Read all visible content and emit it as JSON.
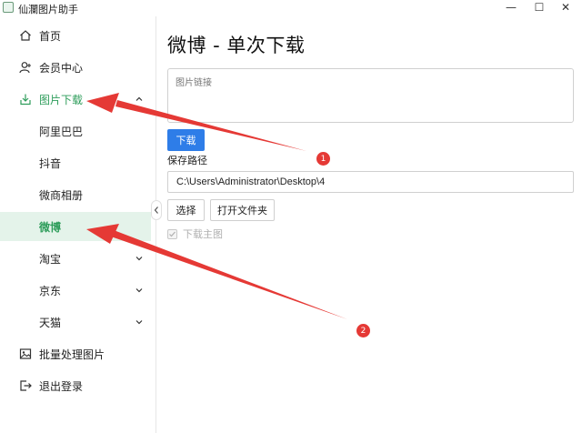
{
  "window": {
    "title": "仙瀾图片助手",
    "controls": {
      "minimize": "—",
      "maximize": "☐",
      "close": "✕"
    }
  },
  "sidebar": {
    "items": [
      {
        "label": "首页",
        "icon": "home-icon"
      },
      {
        "label": "会员中心",
        "icon": "user-icon"
      },
      {
        "label": "图片下载",
        "icon": "download-icon",
        "expanded": true
      },
      {
        "label": "阿里巴巴"
      },
      {
        "label": "抖音"
      },
      {
        "label": "微商相册"
      },
      {
        "label": "微博",
        "selected": true
      },
      {
        "label": "淘宝",
        "has_children": true
      },
      {
        "label": "京东",
        "has_children": true
      },
      {
        "label": "天猫",
        "has_children": true
      },
      {
        "label": "批量处理图片",
        "icon": "image-icon"
      },
      {
        "label": "退出登录",
        "icon": "logout-icon"
      }
    ]
  },
  "main": {
    "title": "微博 - 单次下载",
    "link_placeholder": "图片链接",
    "download_label": "下载",
    "save_path_label": "保存路径",
    "save_path_value": "C:\\Users\\Administrator\\Desktop\\4",
    "choose_label": "选择",
    "open_folder_label": "打开文件夹",
    "download_main_image_label": "下载主图",
    "download_main_image_checked": true
  },
  "annotations": {
    "badges": [
      "1",
      "2"
    ],
    "color": "#e53935"
  },
  "colors": {
    "accent": "#2e9d5b",
    "primary_button": "#2e7de8",
    "selected_bg": "#e4f3ea"
  }
}
